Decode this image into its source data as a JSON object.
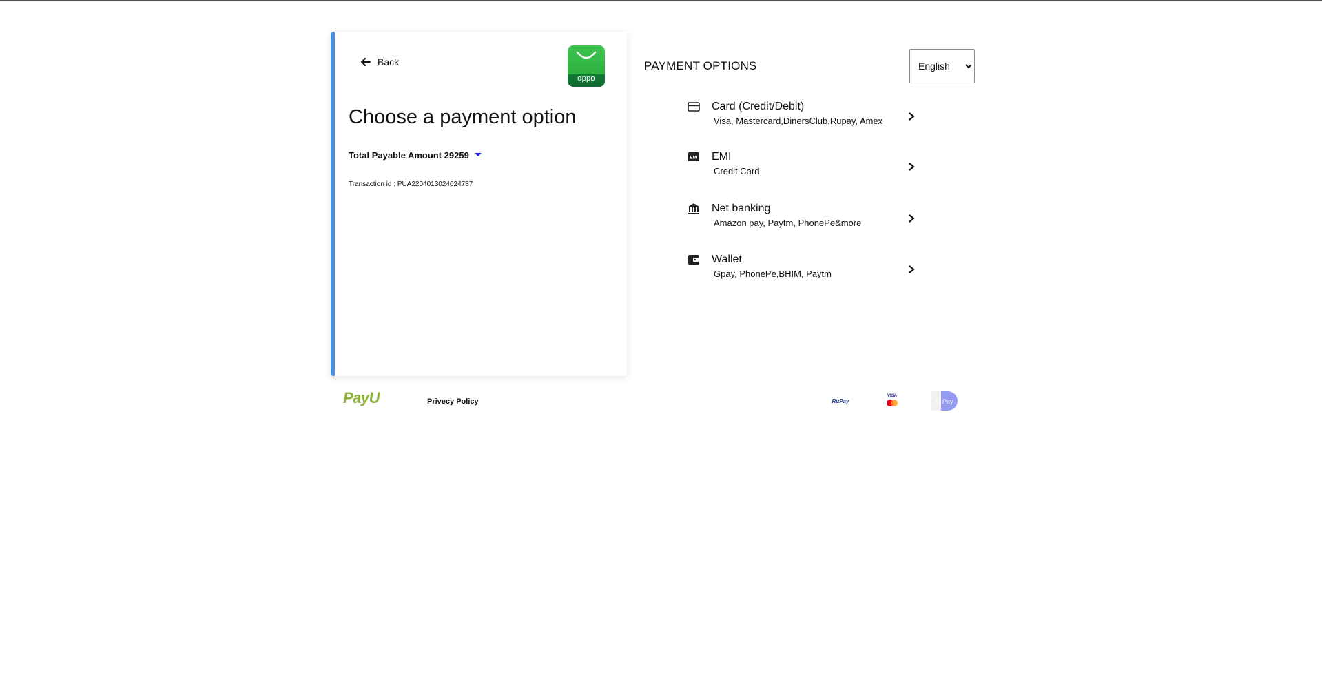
{
  "summary": {
    "back_label": "Back",
    "brand_name": "oppo",
    "title": "Choose a payment option",
    "amount_label": "Total Payable Amount 29259",
    "transaction_label": "Transaction id : PUA2204013024024787"
  },
  "options_panel": {
    "heading": "PAYMENT OPTIONS",
    "language": {
      "selected": "English",
      "options": [
        "English"
      ]
    },
    "items": [
      {
        "icon": "credit-card-icon",
        "title": "Card (Credit/Debit)",
        "subtitle": "Visa, Mastercard,DinersClub,Rupay, Amex"
      },
      {
        "icon": "emi-icon",
        "title": "EMI",
        "subtitle": "Credit Card"
      },
      {
        "icon": "bank-icon",
        "title": "Net banking",
        "subtitle": "Amazon pay, Paytm, PhonePe&more"
      },
      {
        "icon": "wallet-icon",
        "title": "Wallet",
        "subtitle": "Gpay, PhonePe,BHIM, Paytm"
      }
    ]
  },
  "footer": {
    "payu_logo": "PayU",
    "privacy_label": "Privecy Policy",
    "payment_badges": [
      "RuPay",
      "VISA",
      "G Pay"
    ]
  },
  "colors": {
    "accent_border": "#4a90e2",
    "caret": "#1a1aff",
    "brand_green": "#2fb041",
    "payu_green": "#8bb33a"
  }
}
